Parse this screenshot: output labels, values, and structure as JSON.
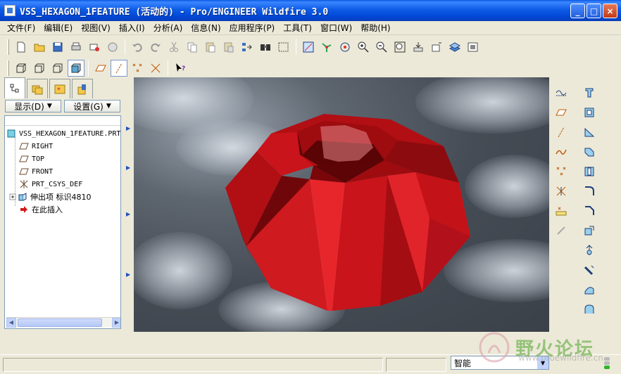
{
  "window": {
    "title": "VSS_HEXAGON_1FEATURE (活动的) - Pro/ENGINEER Wildfire 3.0",
    "controls": [
      "_",
      "□",
      "×"
    ]
  },
  "menu": [
    "文件(F)",
    "编辑(E)",
    "视图(V)",
    "插入(I)",
    "分析(A)",
    "信息(N)",
    "应用程序(P)",
    "工具(T)",
    "窗口(W)",
    "帮助(H)"
  ],
  "toolbar_row1": [
    "new-file-icon",
    "open-folder-icon",
    "save-icon",
    "print-icon",
    "send-mail-icon",
    "mail-open-icon",
    "undo-icon",
    "redo-icon",
    "cut-icon",
    "copy-icon",
    "paste-icon",
    "paste-special-icon",
    "regenerate-icon",
    "find-icon",
    "select-box-icon",
    "refit-icon",
    "spin-center-icon",
    "orient-icon",
    "zoom-in-icon",
    "zoom-out-icon",
    "zoom-fit-icon",
    "repaint-icon",
    "saved-views-icon",
    "layers-icon",
    "view-manager-icon"
  ],
  "toolbar_row2": [
    "wireframe-icon",
    "hidden-line-icon",
    "no-hidden-icon",
    "shading-icon",
    "datum-planes-icon",
    "datum-axes-icon",
    "datum-points-icon",
    "coordinate-systems-icon",
    "context-help-icon"
  ],
  "right_tools_col1": [
    "sketch-datum-curve-icon",
    "datum-plane-icon",
    "datum-axis-icon",
    "datum-curve-icon",
    "datum-point-icon",
    "coordinate-system-icon",
    "analysis-icon",
    "insert-icon"
  ],
  "right_tools_col2": [
    "extrude-icon",
    "revolve-icon",
    "variable-sweep-icon",
    "blend-icon",
    "hole-icon",
    "round-icon",
    "chamfer-icon",
    "draft-icon",
    "shell-icon",
    "rib-icon",
    "mirror-icon",
    "merge-icon",
    "trim-icon",
    "pattern-icon"
  ],
  "left_panel": {
    "tabs": [
      "model-tree-tab",
      "folder-browser-tab",
      "favorites-tab",
      "connections-tab"
    ],
    "show_label": "显示(D)",
    "settings_label": "设置(G)",
    "tree": [
      {
        "label": "VSS_HEXAGON_1FEATURE.PRT",
        "icon": "part-icon"
      },
      {
        "label": "RIGHT",
        "icon": "datum-plane-icon"
      },
      {
        "label": "TOP",
        "icon": "datum-plane-icon"
      },
      {
        "label": "FRONT",
        "icon": "datum-plane-icon"
      },
      {
        "label": "PRT_CSYS_DEF",
        "icon": "coordinate-system-icon"
      },
      {
        "label": "伸出项 标识4810",
        "icon": "protrusion-icon"
      },
      {
        "label": "在此插入",
        "icon": "insert-here-icon"
      }
    ]
  },
  "status": {
    "filter_value": "智能"
  },
  "watermark": {
    "text": "野火论坛",
    "sub": "www.proewildfire.cn"
  },
  "colors": {
    "model_red": "#d11a1a",
    "title_blue": "#0a58e0"
  }
}
